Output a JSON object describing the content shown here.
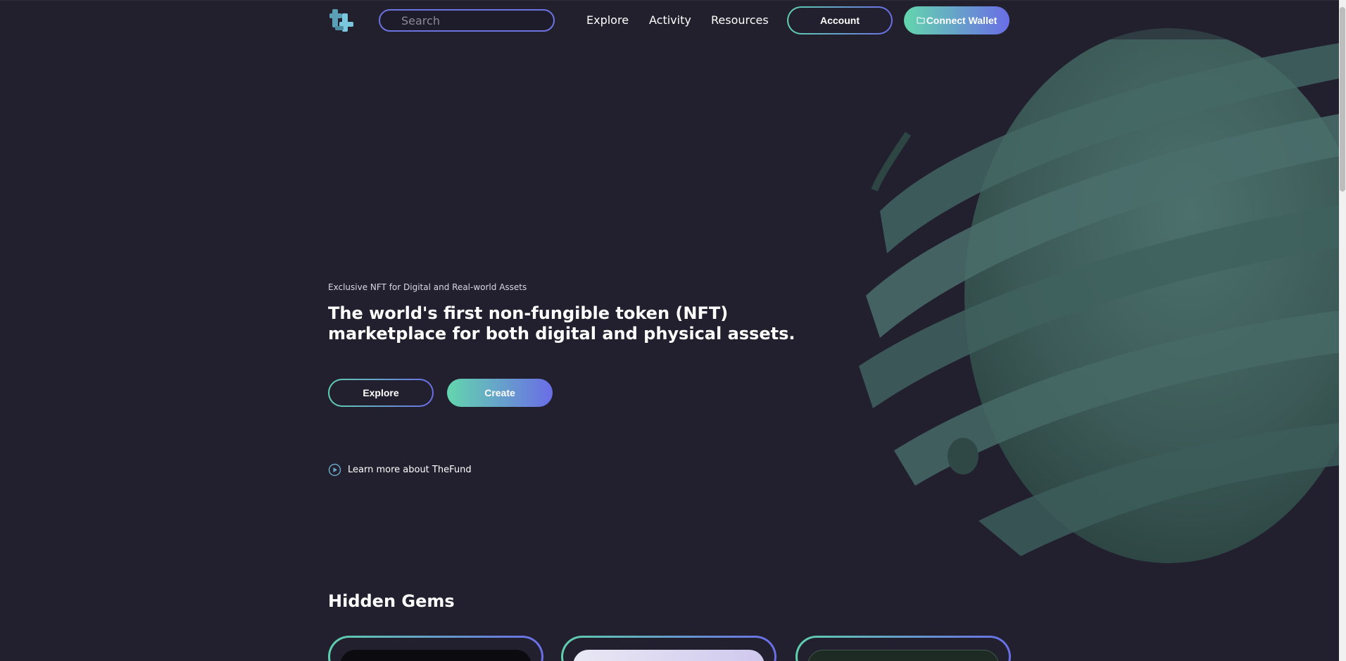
{
  "nav": {
    "search_placeholder": "Search",
    "links": [
      "Explore",
      "Activity",
      "Resources"
    ],
    "account_label": "Account",
    "connect_wallet_label": "Connect Wallet"
  },
  "hero": {
    "eyebrow": "Exclusive NFT for Digital and Real-world Assets",
    "headline": "The world's first non-fungible token (NFT) marketplace for both digital and physical assets.",
    "explore_label": "Explore",
    "create_label": "Create",
    "learn_more_label": "Learn more about TheFund"
  },
  "hidden_gems": {
    "title": "Hidden Gems"
  },
  "icons": {
    "logo": "logo-icon",
    "wallet": "wallet-icon",
    "play": "play-circle-icon"
  },
  "colors": {
    "background": "#22202e",
    "gradient_start": "#5fd0ad",
    "gradient_end": "#6a6de6",
    "sphere": "#3f5f5c"
  }
}
